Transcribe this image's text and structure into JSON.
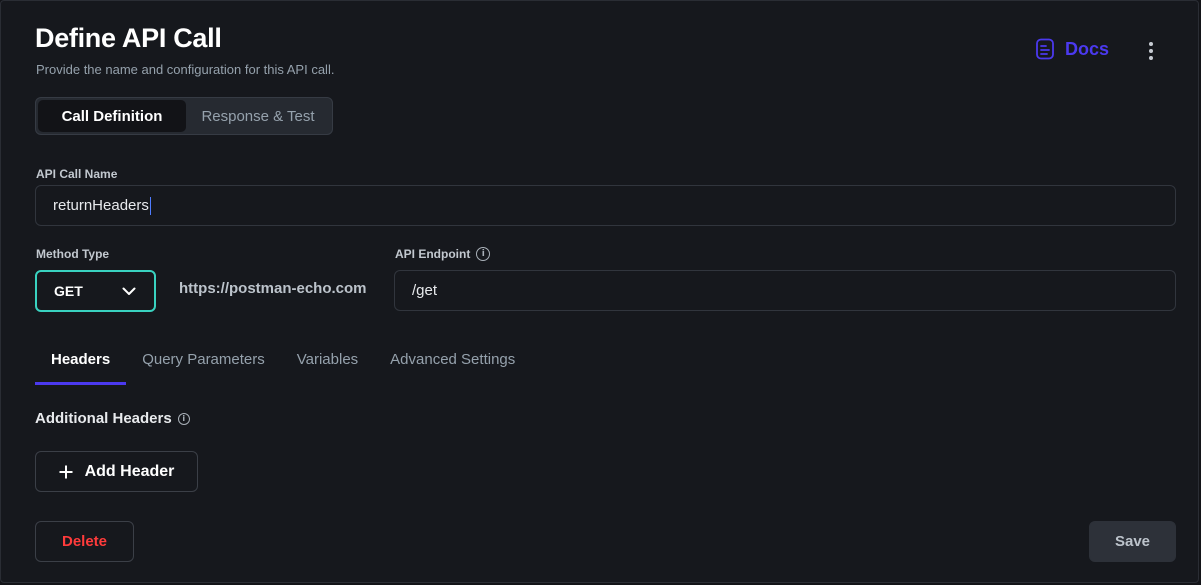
{
  "header": {
    "title": "Define API Call",
    "subtitle": "Provide the name and configuration for this API call.",
    "docs_label": "Docs"
  },
  "segmented": {
    "tabs": [
      {
        "label": "Call Definition",
        "active": true
      },
      {
        "label": "Response & Test",
        "active": false
      }
    ]
  },
  "form": {
    "api_call_name_label": "API Call Name",
    "api_call_name_value": "returnHeaders",
    "method_type_label": "Method Type",
    "method_value": "GET",
    "base_url": "https://postman-echo.com",
    "endpoint_label": "API Endpoint",
    "endpoint_value": "/get"
  },
  "tabs": [
    {
      "label": "Headers",
      "active": true
    },
    {
      "label": "Query Parameters",
      "active": false
    },
    {
      "label": "Variables",
      "active": false
    },
    {
      "label": "Advanced Settings",
      "active": false
    }
  ],
  "headers_section": {
    "title": "Additional Headers",
    "add_button": "Add Header"
  },
  "footer": {
    "delete_label": "Delete",
    "save_label": "Save"
  },
  "colors": {
    "accent": "#4b39ef",
    "method_border": "#39d2c0",
    "delete": "#ff3b3b",
    "background": "#16181d"
  }
}
